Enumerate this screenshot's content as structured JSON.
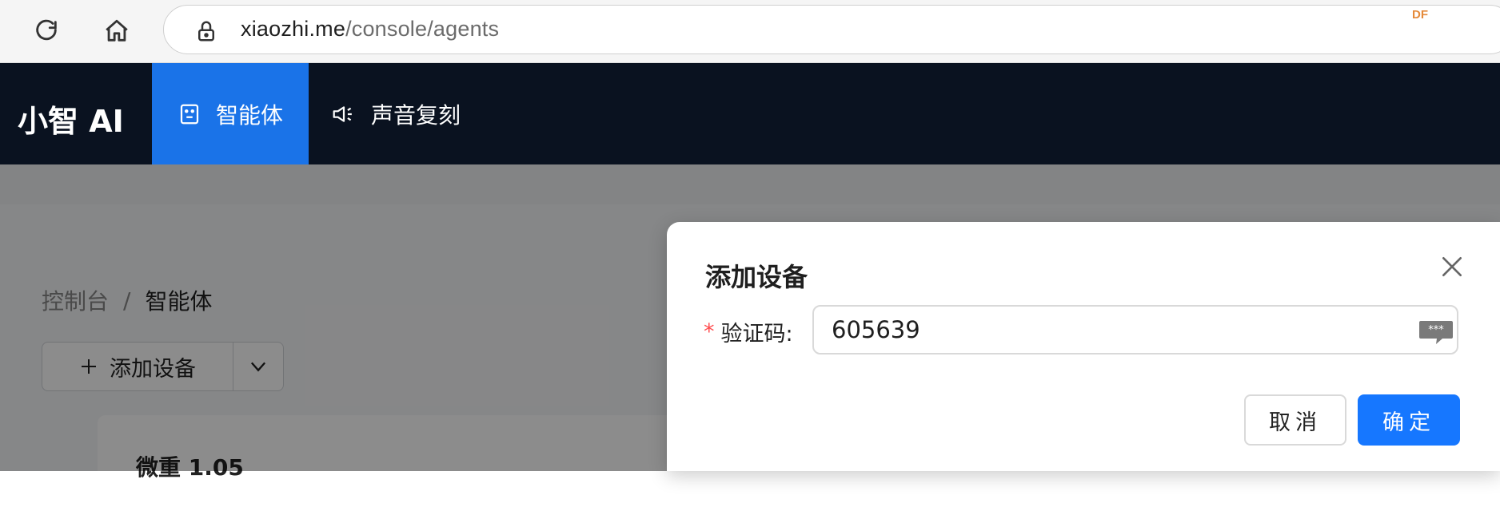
{
  "browser": {
    "url_host": "xiaozhi.me",
    "url_path": "/console/agents",
    "extension_badge": "DF",
    "icons": [
      "reload-icon",
      "home-icon",
      "lock-icon"
    ]
  },
  "app": {
    "logo": "小智 AI",
    "nav": [
      {
        "label": "智能体",
        "icon": "agent-icon",
        "active": true
      },
      {
        "label": "声音复刻",
        "icon": "speaker-icon",
        "active": false
      }
    ]
  },
  "page": {
    "breadcrumb": [
      "控制台",
      "/",
      "智能体"
    ],
    "add_device_label": "添加设备",
    "card_title": "微重 1.05"
  },
  "modal": {
    "title": "添加设备",
    "required_mark": "*",
    "field_label": "验证码:",
    "code_value": "605639",
    "cancel_label": "取消",
    "ok_label": "确定"
  },
  "colors": {
    "header_bg": "#0a1220",
    "active_tab": "#1a73e8",
    "primary_button": "#1677ff",
    "required": "#ff4d4f"
  }
}
